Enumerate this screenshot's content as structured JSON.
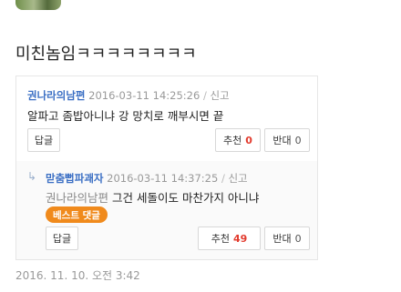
{
  "post": {
    "title": "미친놈임ㅋㅋㅋㅋㅋㅋㅋㅋ",
    "date": "2016. 11. 10. 오전 3:42"
  },
  "comments": [
    {
      "author": "권나라의남편",
      "timestamp": "2016-03-11 14:25:26",
      "report_label": "신고",
      "text": "알파고 좀밥아니냐 강 망치로 깨부시면 끝",
      "reply_label": "답글",
      "up_label": "추천",
      "up_count": "0",
      "down_label": "반대",
      "down_count": "0"
    },
    {
      "author": "맏춤뻡파괘자",
      "timestamp": "2016-03-11 14:37:25",
      "report_label": "신고",
      "mention": "권나라의남편",
      "text": "그건 세돌이도 마찬가지 아니냐",
      "badge": "베스트 댓글",
      "reply_label": "답글",
      "up_label": "추천",
      "up_count": "49",
      "down_label": "반대",
      "down_count": "0"
    }
  ],
  "icons": {
    "reply_arrow": "reply-arrow-icon"
  },
  "colors": {
    "author": "#3b6fc4",
    "up_count": "#e23b2e",
    "badge": "#f08a1c"
  }
}
